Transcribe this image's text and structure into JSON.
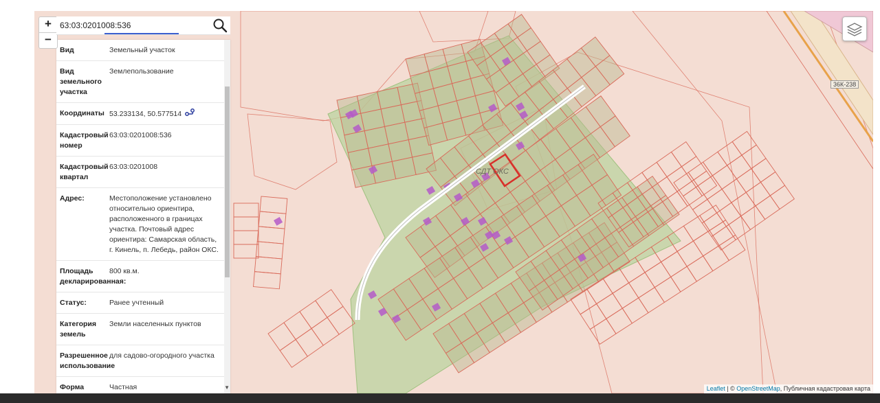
{
  "map": {
    "colors": {
      "background": "#f4ddd3",
      "parcel_border": "#d96a5a",
      "snt_fill": "#bcd3a0",
      "selected_border": "#d8302a",
      "building": "#b45ac8"
    },
    "road_label": "36К-238",
    "snt_label": "СДТ ОКС",
    "attribution": {
      "leaflet": "Leaflet",
      "separator": " | © ",
      "osm": "OpenStreetMap",
      "rest": ", Публичная кадастровая карта"
    }
  },
  "zoom": {
    "in_label": "+",
    "out_label": "−"
  },
  "search": {
    "value": "63:03:0201008:536",
    "icon": "search-icon"
  },
  "layers": {
    "icon": "layers-icon"
  },
  "info": {
    "coordinates_icon": "route-icon",
    "rows": [
      {
        "label": "Вид",
        "value": "Земельный участок"
      },
      {
        "label": "Вид земельного участка",
        "value": "Землепользование"
      },
      {
        "label": "Координаты",
        "value": "53.233134, 50.577514"
      },
      {
        "label": "Кадастровый номер",
        "value": "63:03:0201008:536"
      },
      {
        "label": "Кадастровый квартал",
        "value": "63:03:0201008"
      },
      {
        "label": "Адрес:",
        "value": "Местоположение установлено относительно ориентира, расположенного в границах участка. Почтовый адрес ориентира: Самарская область, г. Кинель, п. Лебедь, район ОКС."
      },
      {
        "label": "Площадь декларированная:",
        "value": "800 кв.м."
      },
      {
        "label": "Статус:",
        "value": "Ранее учтенный"
      },
      {
        "label": "Категория земель",
        "value": "Земли населенных пунктов"
      },
      {
        "label": "Разрешенное использование",
        "value": "для садово-огородного участка"
      },
      {
        "label": "Форма",
        "value": "Частная"
      }
    ]
  }
}
